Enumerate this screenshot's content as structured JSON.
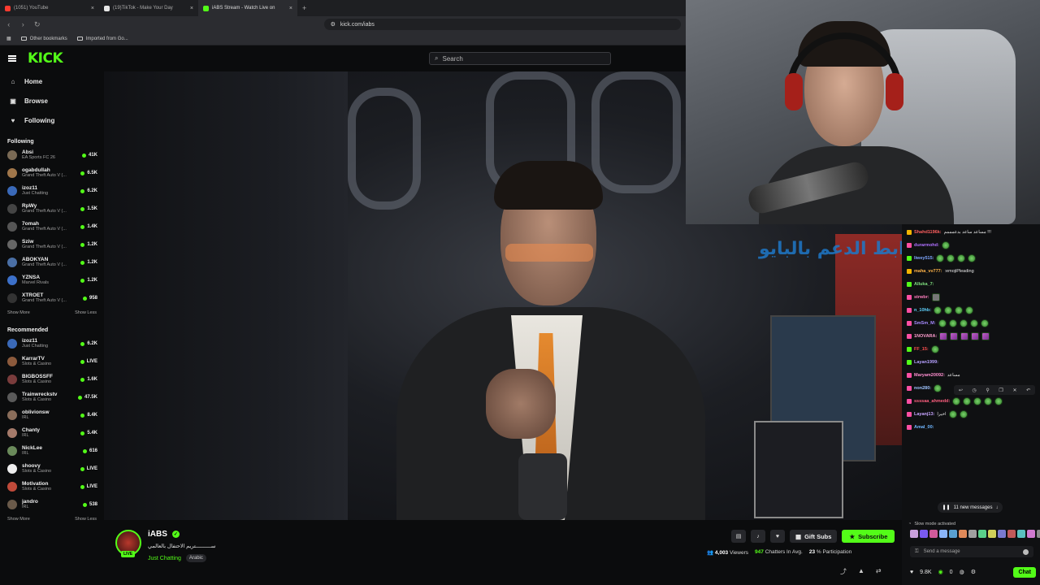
{
  "browser": {
    "tabs": [
      {
        "label": "(1051) YouTube",
        "color": "#ff3b30"
      },
      {
        "label": "(19)TikTok - Make Your Day",
        "color": "#e6e6e6"
      },
      {
        "label": "iABS Stream - Watch Live on",
        "color": "#53fc18",
        "active": true
      }
    ],
    "url": "kick.com/iabs",
    "bookmarks": [
      "Other bookmarks",
      "Imported from Go..."
    ]
  },
  "header": {
    "logo": "KICK",
    "search_placeholder": "Search"
  },
  "sidebar": {
    "nav": [
      {
        "label": "Home",
        "icon": "home-icon",
        "glyph": "⌂"
      },
      {
        "label": "Browse",
        "icon": "browse-icon",
        "glyph": "▣"
      },
      {
        "label": "Following",
        "icon": "heart-icon",
        "glyph": "♥"
      }
    ],
    "following_title": "Following",
    "following": [
      {
        "name": "Absi",
        "category": "EA Sports FC 26",
        "viewers": "41K",
        "color": "#7a6a55"
      },
      {
        "name": "ogabdullah",
        "category": "Grand Theft Auto V (...",
        "viewers": "6.5K",
        "color": "#a0764a"
      },
      {
        "name": "izoz11",
        "category": "Just Chatting",
        "viewers": "6.2K",
        "color": "#3a69b8"
      },
      {
        "name": "RpWy",
        "category": "Grand Theft Auto V (...",
        "viewers": "1.5K",
        "color": "#444"
      },
      {
        "name": "7omah",
        "category": "Grand Theft Auto V (...",
        "viewers": "1.4K",
        "color": "#555"
      },
      {
        "name": "Sziw",
        "category": "Grand Theft Auto V (...",
        "viewers": "1.2K",
        "color": "#666"
      },
      {
        "name": "ABOKYAN",
        "category": "Grand Theft Auto V (...",
        "viewers": "1.2K",
        "color": "#4a6fa5"
      },
      {
        "name": "YZNSA",
        "category": "Marvel Rivals",
        "viewers": "1.2K",
        "color": "#3c70c9"
      },
      {
        "name": "XTROET",
        "category": "Grand Theft Auto V (...",
        "viewers": "958",
        "color": "#333"
      }
    ],
    "show_more": "Show More",
    "show_less": "Show Less",
    "recommended_title": "Recommended",
    "recommended": [
      {
        "name": "izoz11",
        "category": "Just Chatting",
        "viewers": "6.2K",
        "color": "#3a69b8"
      },
      {
        "name": "KarrarTV",
        "category": "Slots & Casino",
        "viewers": "LIVE",
        "color": "#8c5a3c"
      },
      {
        "name": "BIGBOSSFF",
        "category": "Slots & Casino",
        "viewers": "1.6K",
        "color": "#7a3c3c"
      },
      {
        "name": "Trainwreckstv",
        "category": "Slots & Casino",
        "viewers": "47.5K",
        "color": "#5a5a5a"
      },
      {
        "name": "oblivionsw",
        "category": "IRL",
        "viewers": "8.4K",
        "color": "#8a6d5a"
      },
      {
        "name": "Chanty",
        "category": "IRL",
        "viewers": "5.4K",
        "color": "#a57a6a"
      },
      {
        "name": "NickLee",
        "category": "IRL",
        "viewers": "616",
        "color": "#6a8a5a"
      },
      {
        "name": "shoovy",
        "category": "Slots & Casino",
        "viewers": "LIVE",
        "color": "#eeeeee"
      },
      {
        "name": "Motivation",
        "category": "Slots & Casino",
        "viewers": "LIVE",
        "color": "#c04a3a"
      },
      {
        "name": "jandro",
        "category": "IRL",
        "viewers": "538",
        "color": "#6a5a4a"
      }
    ]
  },
  "video": {
    "overlay_text": "رابط الدعم بالبايو"
  },
  "stream": {
    "name": "iABS",
    "title": "ســــــــــتريم الاحتفال بالعالمي",
    "category": "Just Chatting",
    "tag": "Arabic",
    "live_label": "LIVE",
    "gift_label": "Gift Subs",
    "subscribe_label": "Subscribe",
    "viewers": "4,003",
    "viewers_label": "Viewers",
    "chatters": "947",
    "chatters_label": "Chatters In Avg.",
    "participation": "23",
    "participation_label": "% Participation"
  },
  "chat": {
    "messages": [
      {
        "user": "Shahd1196k:",
        "color": "#ff5f5f",
        "text": "مساعد ساعد بدعمممم !!!",
        "badge": "y"
      },
      {
        "user": "durarmohd:",
        "color": "#b070ff",
        "emotes": 1,
        "badge": "p"
      },
      {
        "user": "liwey515:",
        "color": "#7fa7ff",
        "emotes": 4,
        "badge": "g"
      },
      {
        "user": "maha_vv777:",
        "color": "#ffb347",
        "text": ":emojiPleading",
        "badge": "y"
      },
      {
        "user": "Alluka_7:",
        "color": "#7fe07f",
        "text": "",
        "badge": "g"
      },
      {
        "user": "strwbr:",
        "color": "#ff7fbf",
        "emotes": 1,
        "emote_kind": "gray",
        "badge": "p"
      },
      {
        "user": "n_10hb:",
        "color": "#5fd3ff",
        "emotes": 4,
        "badge": "p"
      },
      {
        "user": "SmSm_M:",
        "color": "#a78bff",
        "emotes": 5,
        "badge": "p"
      },
      {
        "user": "1NOVARA:",
        "color": "#ff9ecf",
        "emotes": 5,
        "emote_kind": "pink",
        "badge": "p"
      },
      {
        "user": "FF_15:",
        "color": "#ff4f4f",
        "emotes": 1,
        "badge": "g"
      },
      {
        "user": "Layan1999:",
        "color": "#b6a0ff",
        "text": "",
        "badge": "g"
      },
      {
        "user": "Maryam20092:",
        "color": "#ff8fd0",
        "text": "مساعد",
        "badge": "p"
      },
      {
        "user": "non280:",
        "color": "#9fc4ff",
        "emotes": 1,
        "badge": "p"
      },
      {
        "user": "ssssaa_ahmedd:",
        "color": "#ff5f7f",
        "emotes": 5,
        "badge": "p"
      },
      {
        "user": "Layanj13:",
        "color": "#c7a4ff",
        "text": "اخيرا",
        "emotes": 2,
        "badge": "p"
      },
      {
        "user": "Amal_00:",
        "color": "#6fb6ff",
        "text": "",
        "badge": "p"
      }
    ],
    "new_messages": "11 new messages",
    "slow_mode": "Slow mode activated",
    "input_placeholder": "Send a message",
    "likes": "9.8K",
    "points": "0",
    "chat_button": "Chat"
  }
}
